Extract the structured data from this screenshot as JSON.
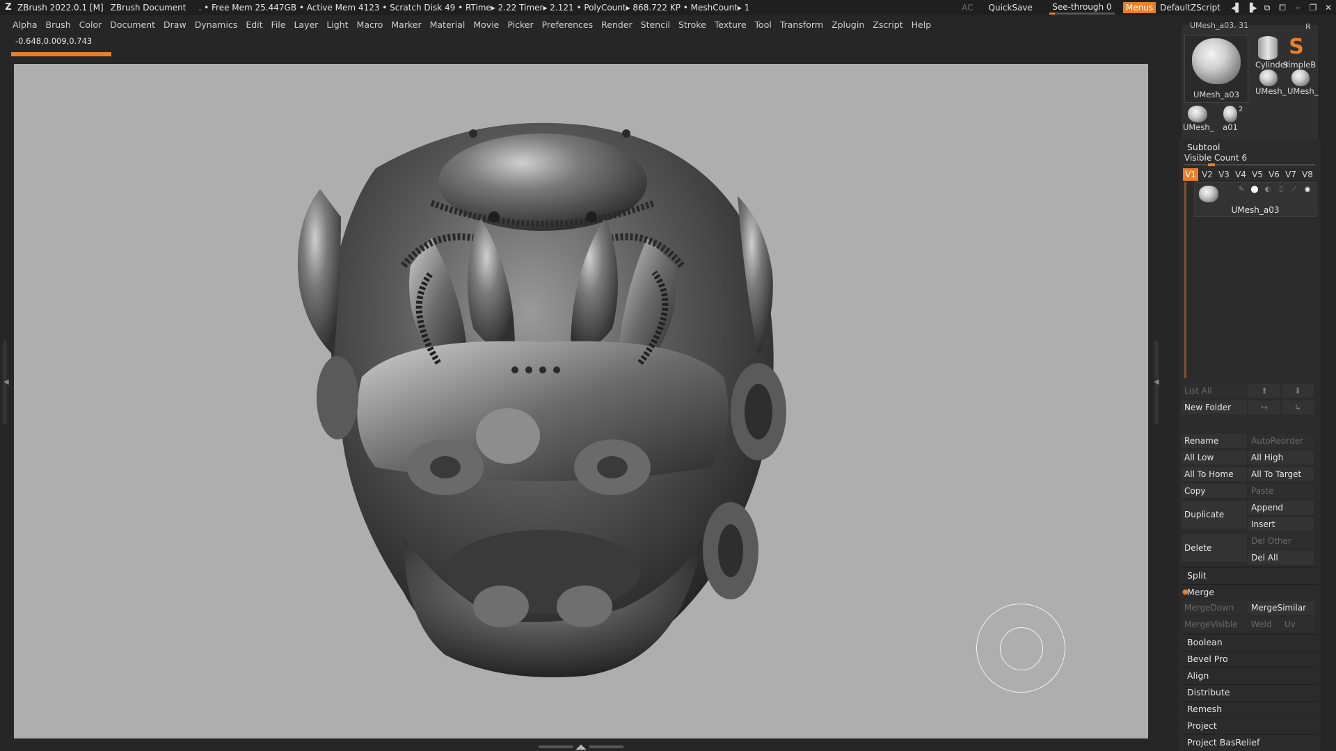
{
  "titlebar": {
    "app": "ZBrush 2022.0.1 [M]",
    "document": "ZBrush Document",
    "stats": ". • Free Mem 25.447GB • Active Mem 4123 • Scratch Disk 49 •  RTime▸ 2.22 Timer▸ 2.121 • PolyCount▸ 868.722 KP  • MeshCount▸ 1",
    "ac": "AC",
    "quicksave": "QuickSave",
    "seethrough": "See-through   0",
    "menus": "Menus",
    "default_zscript": "DefaultZScript"
  },
  "menubar": [
    "Alpha",
    "Brush",
    "Color",
    "Document",
    "Draw",
    "Dynamics",
    "Edit",
    "File",
    "Layer",
    "Light",
    "Macro",
    "Marker",
    "Material",
    "Movie",
    "Picker",
    "Preferences",
    "Render",
    "Stencil",
    "Stroke",
    "Texture",
    "Tool",
    "Transform",
    "Zplugin",
    "Zscript",
    "Help"
  ],
  "coords": "-0.648,0.009,0.743",
  "tool_palette": {
    "top_label": "UMesh_a03. 31",
    "r_label": "R",
    "thumbs": [
      {
        "label": "UMesh_a03"
      },
      {
        "label": "Cylinder"
      },
      {
        "label": "SimpleB"
      },
      {
        "label": "UMesh_"
      },
      {
        "label": "UMesh_"
      },
      {
        "label": "UMesh_"
      },
      {
        "label": "a01"
      },
      {
        "label": "2"
      }
    ]
  },
  "subtool": {
    "title": "Subtool",
    "visible_count": "Visible Count 6",
    "tabs": [
      "V1",
      "V2",
      "V3",
      "V4",
      "V5",
      "V6",
      "V7",
      "V8"
    ],
    "active_tab": "V1",
    "item_name": "UMesh_a03"
  },
  "buttons": {
    "list_all": "List All",
    "new_folder": "New Folder",
    "rename": "Rename",
    "auto_reorder": "AutoReorder",
    "all_low": "All Low",
    "all_high": "All High",
    "all_to_home": "All To Home",
    "all_to_target": "All To Target",
    "copy": "Copy",
    "paste": "Paste",
    "duplicate": "Duplicate",
    "append": "Append",
    "insert": "Insert",
    "delete": "Delete",
    "del_other": "Del Other",
    "del_all": "Del All"
  },
  "sections": {
    "split": "Split",
    "merge": "Merge",
    "merge_down": "MergeDown",
    "merge_similar": "MergeSimilar",
    "merge_visible": "MergeVisible",
    "weld": "Weld",
    "uv": "Uv",
    "boolean": "Boolean",
    "bevel_pro": "Bevel Pro",
    "align": "Align",
    "distribute": "Distribute",
    "remesh": "Remesh",
    "project": "Project",
    "project_basrelief": "Project BasRelief"
  },
  "colors": {
    "accent": "#e97f2a",
    "viewport_bg": "#aeaeae",
    "ui_bg": "#262626"
  }
}
